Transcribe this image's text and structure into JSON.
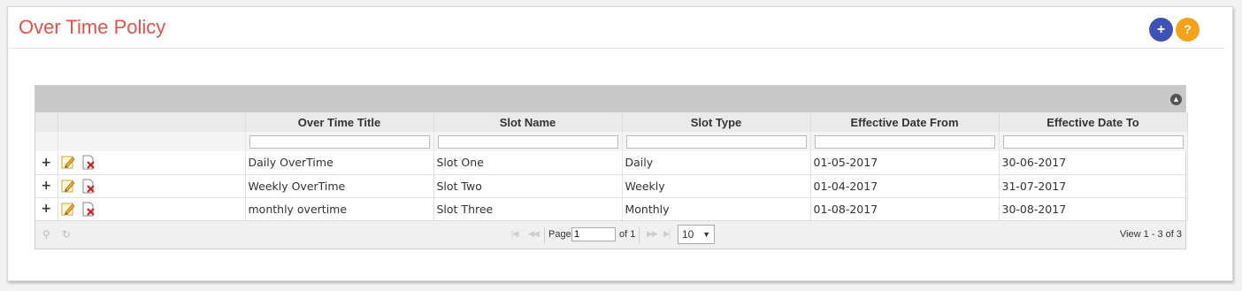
{
  "panel": {
    "title": "Over Time Policy",
    "add_icon": "+",
    "help_icon": "?"
  },
  "grid": {
    "columns": [
      "Over Time Title",
      "Slot Name",
      "Slot Type",
      "Effective Date From",
      "Effective Date To"
    ],
    "rows": [
      [
        "Daily OverTime",
        "Slot One",
        "Daily",
        "01-05-2017",
        "30-06-2017"
      ],
      [
        "Weekly OverTime",
        "Slot Two",
        "Weekly",
        "01-04-2017",
        "31-07-2017"
      ],
      [
        "monthly overtime",
        "Slot Three",
        "Monthly",
        "01-08-2017",
        "30-08-2017"
      ]
    ],
    "expand_glyph": "+"
  },
  "pager": {
    "page_label": "Page",
    "page_value": "1",
    "of_label": "of 1",
    "rows_per_page": "10",
    "view_text": "View 1 - 3 of 3"
  }
}
